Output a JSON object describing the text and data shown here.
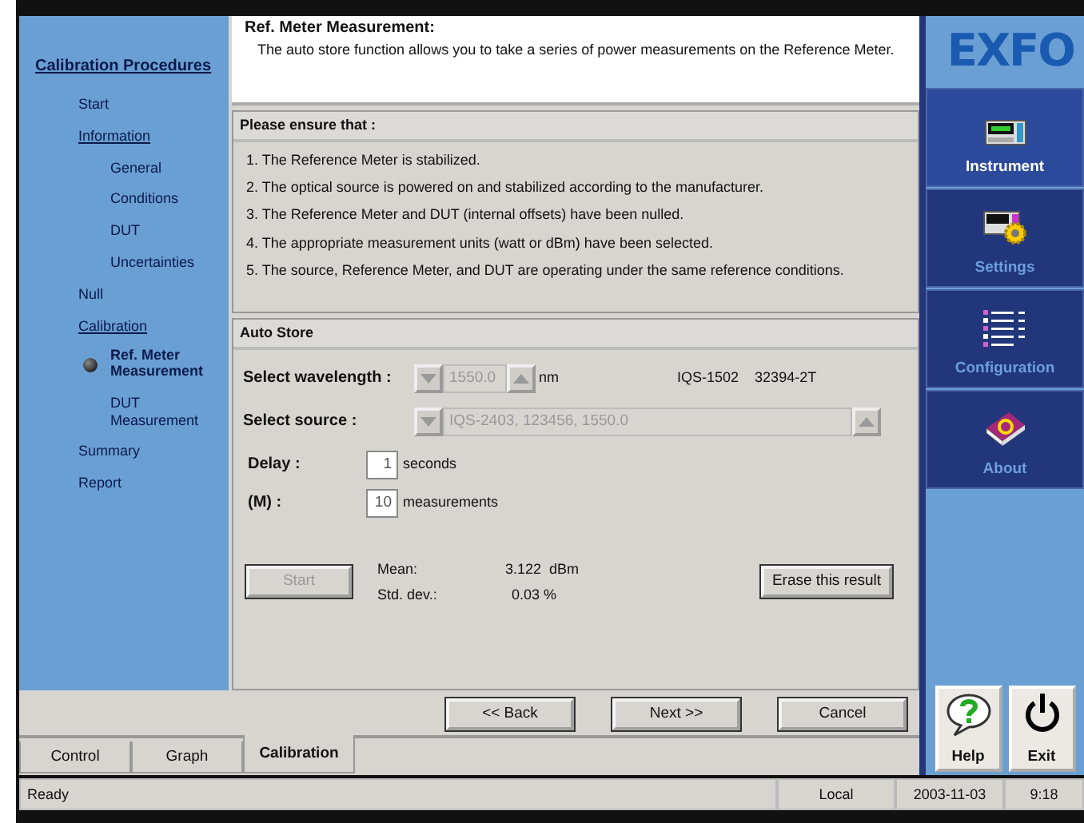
{
  "sidebar": {
    "items": [
      {
        "label": "Calibration Procedures",
        "kind": "heading",
        "selected": false
      },
      {
        "label": "Start",
        "kind": "step",
        "selected": false
      },
      {
        "label": "Information",
        "kind": "group",
        "selected": false,
        "children": [
          {
            "label": "General",
            "kind": "step",
            "selected": false
          },
          {
            "label": "Conditions",
            "kind": "step",
            "selected": false
          },
          {
            "label": "DUT",
            "kind": "step",
            "selected": false
          },
          {
            "label": "Uncertainties",
            "kind": "step",
            "selected": false
          }
        ]
      },
      {
        "label": "Null",
        "kind": "step",
        "selected": false
      },
      {
        "label": "Calibration",
        "kind": "group",
        "selected": false,
        "children": [
          {
            "label": "Ref. Meter Measurement",
            "kind": "step",
            "selected": true
          },
          {
            "label": "DUT Measurement",
            "kind": "step",
            "selected": false
          }
        ]
      },
      {
        "label": "Summary",
        "kind": "step",
        "selected": false
      },
      {
        "label": "Report",
        "kind": "step",
        "selected": false
      }
    ]
  },
  "header": {
    "title": "Ref. Meter Measurement:",
    "description": "The auto store function allows you to take a series of power measurements on the Reference Meter."
  },
  "checklist": {
    "title": "Please ensure that :",
    "items": [
      "1. The Reference Meter is stabilized.",
      "2. The optical source is powered on and stabilized according to the manufacturer.",
      "3. The Reference Meter and DUT (internal offsets) have been nulled.",
      "4. The appropriate measurement units (watt or dBm) have been selected.",
      "5. The source, Reference Meter, and DUT are operating under the same reference conditions."
    ]
  },
  "auto_store": {
    "title": "Auto Store",
    "wavelength": {
      "label": "Select wavelength :",
      "value": "1550.0",
      "unit": "nm",
      "disabled": true
    },
    "meter_model": "IQS-1502",
    "meter_serial": "32394-2T",
    "source": {
      "label": "Select source :",
      "value": "IQS-2403, 123456, 1550.0",
      "disabled": true
    },
    "delay": {
      "label": "Delay :",
      "value": "1",
      "unit": "seconds"
    },
    "count": {
      "label": "(M) :",
      "value": "10",
      "unit": "measurements"
    },
    "start_button": {
      "label": "Start",
      "disabled": true
    },
    "mean": {
      "label": "Mean:",
      "value": "3.122  dBm"
    },
    "std_dev": {
      "label": "Std. dev.:",
      "value": "0.03 %"
    },
    "erase_button": {
      "label": "Erase this result"
    }
  },
  "wizard_buttons": [
    "<< Back",
    "Next >>",
    "Cancel"
  ],
  "tabs": [
    {
      "label": "Control",
      "selected": false
    },
    {
      "label": "Graph",
      "selected": false
    },
    {
      "label": "Calibration",
      "selected": true
    }
  ],
  "right_panel": {
    "logo": "EXFO",
    "items": [
      {
        "label": "Instrument",
        "selected": true
      },
      {
        "label": "Settings",
        "selected": false
      },
      {
        "label": "Configuration",
        "selected": false
      },
      {
        "label": "About",
        "selected": false
      }
    ],
    "buttons": [
      {
        "label": "Help"
      },
      {
        "label": "Exit"
      }
    ]
  },
  "status_bar": {
    "message": "Ready",
    "mode": "Local",
    "date": "2003-11-03",
    "time": "9:18"
  }
}
